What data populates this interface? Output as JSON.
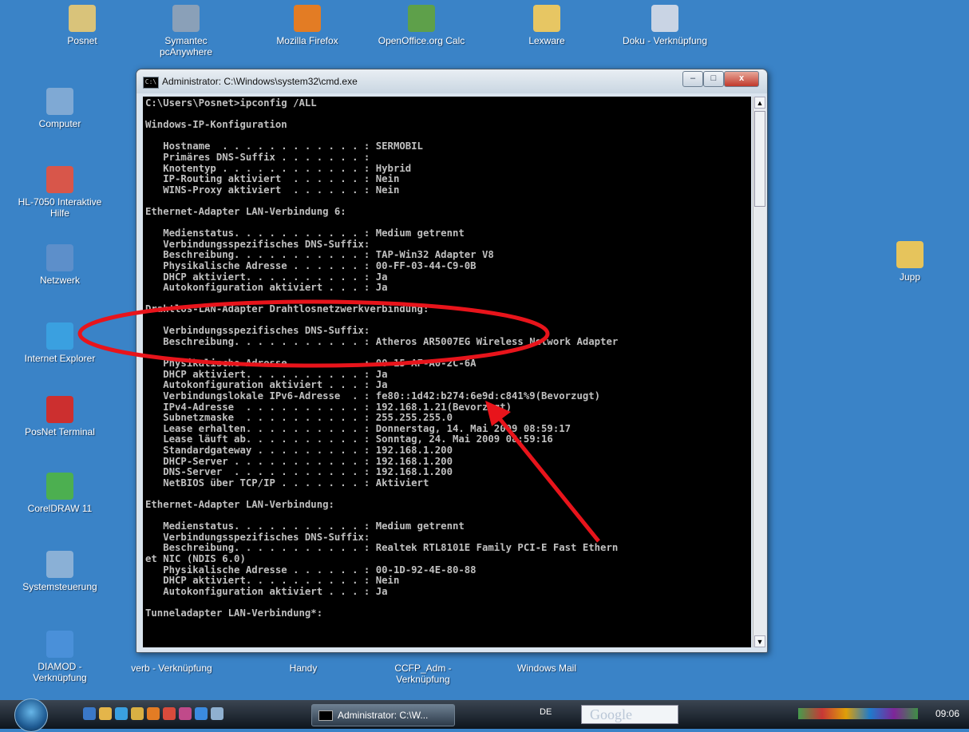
{
  "desktop_top": [
    {
      "label": "Posnet",
      "color": "#d9c37a"
    },
    {
      "label": "Symantec pcAnywhere",
      "color": "#8aa0b8"
    },
    {
      "label": "Mozilla Firefox",
      "color": "#e37c24"
    },
    {
      "label": "OpenOffice.org Calc",
      "color": "#5ea04a"
    },
    {
      "label": "Lexware",
      "color": "#e7c663"
    },
    {
      "label": "Doku - Verknüpfung",
      "color": "#c9d4e4"
    }
  ],
  "desktop_left": [
    {
      "label": "Computer",
      "color": "#7fa9d4"
    },
    {
      "label": "HL-7050 Interaktive Hilfe",
      "color": "#d8564a"
    },
    {
      "label": "Netzwerk",
      "color": "#5d8fca"
    },
    {
      "label": "Internet Explorer",
      "color": "#3aa0e0"
    },
    {
      "label": "PosNet Terminal",
      "color": "#cc2f2f"
    },
    {
      "label": "CorelDRAW 11",
      "color": "#4caf50"
    },
    {
      "label": "Systemsteuerung",
      "color": "#8ab0d6"
    },
    {
      "label": "DIAMOD - Verknüpfung",
      "color": "#4a90d9"
    }
  ],
  "desktop_right": {
    "label": "Jupp",
    "color": "#e6c45c"
  },
  "desktop_bottom": [
    {
      "label": "verb - Verknüpfung"
    },
    {
      "label": "Handy"
    },
    {
      "label": "CCFP_Adm - Verknüpfung"
    },
    {
      "label": "Windows Mail"
    }
  ],
  "window": {
    "title": "Administrator: C:\\Windows\\system32\\cmd.exe",
    "icon_text": "C:\\",
    "minimize": "–",
    "maximize": "□",
    "close": "x",
    "console_text": "C:\\Users\\Posnet>ipconfig /ALL\n\nWindows-IP-Konfiguration\n\n   Hostname  . . . . . . . . . . . . : SERMOBIL\n   Primäres DNS-Suffix . . . . . . . :\n   Knotentyp . . . . . . . . . . . . : Hybrid\n   IP-Routing aktiviert  . . . . . . : Nein\n   WINS-Proxy aktiviert  . . . . . . : Nein\n\nEthernet-Adapter LAN-Verbindung 6:\n\n   Medienstatus. . . . . . . . . . . : Medium getrennt\n   Verbindungsspezifisches DNS-Suffix:\n   Beschreibung. . . . . . . . . . . : TAP-Win32 Adapter V8\n   Physikalische Adresse . . . . . . : 00-FF-03-44-C9-0B\n   DHCP aktiviert. . . . . . . . . . : Ja\n   Autokonfiguration aktiviert . . . : Ja\n\nDrahtlos-LAN-Adapter Drahtlosnetzwerkverbindung:\n\n   Verbindungsspezifisches DNS-Suffix:\n   Beschreibung. . . . . . . . . . . : Atheros AR5007EG Wireless Network Adapter\n\n   Physikalische Adresse . . . . . . : 00-15-AF-A0-2C-6A\n   DHCP aktiviert. . . . . . . . . . : Ja\n   Autokonfiguration aktiviert . . . : Ja\n   Verbindungslokale IPv6-Adresse  . : fe80::1d42:b274:6e9d:c841%9(Bevorzugt)\n   IPv4-Adresse  . . . . . . . . . . : 192.168.1.21(Bevorzugt)\n   Subnetzmaske  . . . . . . . . . . : 255.255.255.0\n   Lease erhalten. . . . . . . . . . : Donnerstag, 14. Mai 2009 08:59:17\n   Lease läuft ab. . . . . . . . . . : Sonntag, 24. Mai 2009 08:59:16\n   Standardgateway . . . . . . . . . : 192.168.1.200\n   DHCP-Server . . . . . . . . . . . : 192.168.1.200\n   DNS-Server  . . . . . . . . . . . : 192.168.1.200\n   NetBIOS über TCP/IP . . . . . . . : Aktiviert\n\nEthernet-Adapter LAN-Verbindung:\n\n   Medienstatus. . . . . . . . . . . : Medium getrennt\n   Verbindungsspezifisches DNS-Suffix:\n   Beschreibung. . . . . . . . . . . : Realtek RTL8101E Family PCI-E Fast Ethern\net NIC (NDIS 6.0)\n   Physikalische Adresse . . . . . . : 00-1D-92-4E-80-88\n   DHCP aktiviert. . . . . . . . . . : Nein\n   Autokonfiguration aktiviert . . . : Ja\n\nTunneladapter LAN-Verbindung*:"
  },
  "taskbar": {
    "task_button": "Administrator: C:\\W...",
    "language": "DE",
    "search_text": "Google",
    "clock": "09:06"
  },
  "annotation_color": "#e8141b"
}
